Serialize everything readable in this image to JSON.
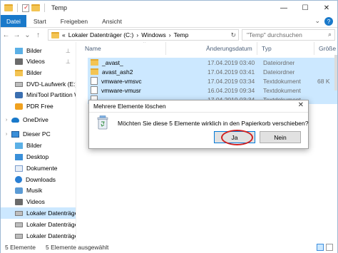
{
  "window": {
    "title": "Temp"
  },
  "window_controls": {
    "minimize": "—",
    "maximize": "☐",
    "close": "✕"
  },
  "ribbon": {
    "tabs": [
      "Datei",
      "Start",
      "Freigeben",
      "Ansicht"
    ],
    "expand": "⌄",
    "help": "?"
  },
  "nav": {
    "back": "←",
    "forward": "→",
    "recent": "⌄",
    "up": "↑"
  },
  "address": {
    "segments": [
      "Lokaler Datenträger (C:)",
      "Windows",
      "Temp"
    ],
    "separator": "›",
    "prefix": "«",
    "refresh": "↻"
  },
  "search": {
    "placeholder": "\"Temp\" durchsuchen",
    "icon": "⌕"
  },
  "sidebar": {
    "items": [
      {
        "label": "Bilder",
        "icon": "pictures",
        "pinned": true,
        "selected": false
      },
      {
        "label": "Videos",
        "icon": "video",
        "pinned": true,
        "selected": false
      },
      {
        "label": "Bilder",
        "icon": "folder",
        "pinned": false,
        "selected": false
      },
      {
        "label": "DVD-Laufwerk (E:)",
        "icon": "drive",
        "pinned": false,
        "selected": false
      },
      {
        "label": "MiniTool Partition W",
        "icon": "app",
        "pinned": false,
        "selected": false
      },
      {
        "label": "PDR Free",
        "icon": "pdr",
        "pinned": false,
        "selected": false
      },
      {
        "label": "OneDrive",
        "icon": "cloud",
        "pinned": false,
        "selected": false
      },
      {
        "label": "Dieser PC",
        "icon": "pc",
        "pinned": false,
        "selected": false
      },
      {
        "label": "Bilder",
        "icon": "pictures",
        "pinned": false,
        "selected": false
      },
      {
        "label": "Desktop",
        "icon": "desktop",
        "pinned": false,
        "selected": false
      },
      {
        "label": "Dokumente",
        "icon": "documents",
        "pinned": false,
        "selected": false
      },
      {
        "label": "Downloads",
        "icon": "download",
        "pinned": false,
        "selected": false
      },
      {
        "label": "Musik",
        "icon": "music",
        "pinned": false,
        "selected": false
      },
      {
        "label": "Videos",
        "icon": "video",
        "pinned": false,
        "selected": false
      },
      {
        "label": "Lokaler Datenträger",
        "icon": "drive",
        "pinned": false,
        "selected": true
      },
      {
        "label": "Lokaler Datenträger",
        "icon": "drive",
        "pinned": false,
        "selected": false
      },
      {
        "label": "Lokaler Datenträger",
        "icon": "drive",
        "pinned": false,
        "selected": false
      }
    ],
    "pin_glyph": "📌",
    "expand_glyph": "›"
  },
  "file_list": {
    "columns": [
      "Name",
      "Änderungsdatum",
      "Typ",
      "Größe"
    ],
    "sort_glyph": "^",
    "rows": [
      {
        "name": "_avast_",
        "date": "17.04.2019 03:40",
        "type": "Dateiordner",
        "size": "",
        "kind": "folder"
      },
      {
        "name": "avast_ash2",
        "date": "17.04.2019 03:41",
        "type": "Dateiordner",
        "size": "",
        "kind": "folder"
      },
      {
        "name": "vmware-vmsvc",
        "date": "17.04.2019 03:34",
        "type": "Textdokument",
        "size": "68 K",
        "kind": "text"
      },
      {
        "name": "vmware-vmusr",
        "date": "16.04.2019 09:34",
        "type": "Textdokument",
        "size": "",
        "kind": "text"
      },
      {
        "name": "",
        "date": "17.04.2019 03:34",
        "type": "Textdokument",
        "size": "",
        "kind": "text"
      }
    ]
  },
  "dialog": {
    "title": "Mehrere Elemente löschen",
    "message": "Möchten Sie diese 5 Elemente wirklich in den Papierkorb verschieben?",
    "yes": "Ja",
    "no": "Nein",
    "close": "✕"
  },
  "status": {
    "count": "5 Elemente",
    "selected": "5 Elemente ausgewählt"
  },
  "colors": {
    "accent": "#1979ca",
    "selection": "#cce8ff",
    "highlight_ring": "#d02020"
  }
}
